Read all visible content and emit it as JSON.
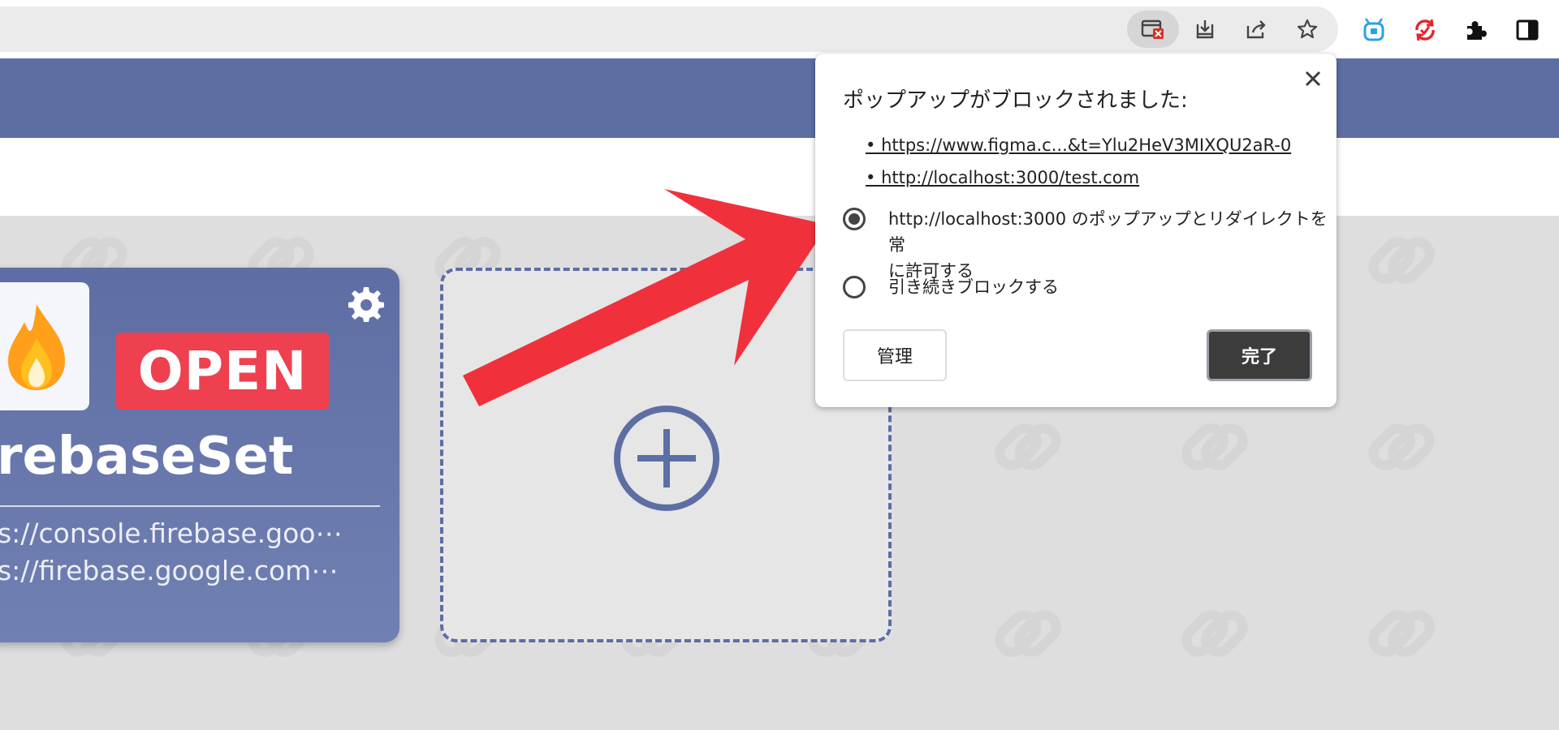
{
  "browser": {
    "toolbar_icons": [
      "popup-blocked-icon",
      "install-icon",
      "share-icon",
      "bookmark-star-icon"
    ],
    "extension_icons": [
      "bot-extension-icon",
      "sync-extension-icon",
      "puzzle-extensions-icon",
      "side-panel-icon"
    ]
  },
  "card": {
    "badge": "OPEN",
    "title": "irebaseSet",
    "urls": [
      "ps://console.firebase.goo⋯",
      "ps://firebase.google.com⋯"
    ],
    "accent": "#5d6ea3",
    "badge_color": "#ef4050"
  },
  "popup": {
    "title": "ポップアップがブロックされました:",
    "links": [
      "https://www.figma.c...&t=Ylu2HeV3MIXQU2aR-0",
      "http://localhost:3000/test.com"
    ],
    "options": [
      {
        "line1": "http://localhost:3000 のポップアップとリダイレクトを常",
        "line2": "に許可する",
        "selected": true
      },
      {
        "line1": "引き続きブロックする",
        "line2": "",
        "selected": false
      }
    ],
    "manage_label": "管理",
    "done_label": "完了"
  },
  "colors": {
    "header": "#5d6ea3",
    "arrow": "#f0313c"
  }
}
